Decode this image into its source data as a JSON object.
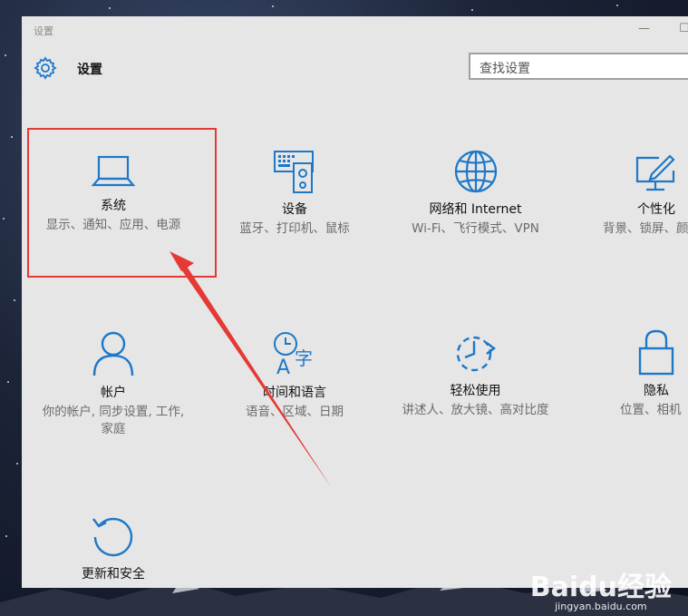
{
  "window": {
    "title": "设置",
    "minimize_glyph": "—",
    "maximize_glyph": "☐"
  },
  "header": {
    "title": "设置",
    "search_placeholder": "查找设置"
  },
  "tiles": [
    {
      "label": "系统",
      "desc": "显示、通知、应用、电源",
      "icon": "laptop-icon"
    },
    {
      "label": "设备",
      "desc": "蓝牙、打印机、鼠标",
      "icon": "devices-icon"
    },
    {
      "label": "网络和 Internet",
      "desc": "Wi-Fi、飞行模式、VPN",
      "icon": "globe-icon"
    },
    {
      "label": "个性化",
      "desc": "背景、锁屏、颜",
      "icon": "personalization-icon"
    },
    {
      "label": "帐户",
      "desc": "你的帐户, 同步设置, 工作, 家庭",
      "icon": "person-icon"
    },
    {
      "label": "时间和语言",
      "desc": "语音、区域、日期",
      "icon": "time-language-icon"
    },
    {
      "label": "轻松使用",
      "desc": "讲述人、放大镜、高对比度",
      "icon": "ease-of-access-icon"
    },
    {
      "label": "隐私",
      "desc": "位置、相机",
      "icon": "lock-icon"
    },
    {
      "label": "更新和安全",
      "desc": "",
      "icon": "update-icon"
    }
  ],
  "colors": {
    "accent": "#1e78c8",
    "annotation": "#e53935",
    "window_bg": "#e6e6e6"
  },
  "watermark": {
    "logo": "Baidu经验",
    "url": "jingyan.baidu.com"
  }
}
